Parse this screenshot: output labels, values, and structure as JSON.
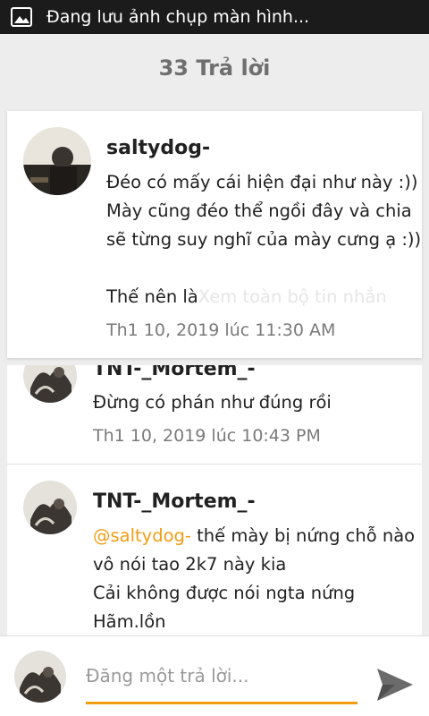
{
  "status_bar": {
    "icon": "image-icon",
    "text": "Đang lưu ảnh chụp màn hình..."
  },
  "header": {
    "title": "33 Trả lời"
  },
  "comments": [
    {
      "author": "saltydog-",
      "lines": [
        "Đéo có mấy cái hiện đại như này :))",
        "Mày cũng đéo thể ngồi đây và chia",
        "sẽ từng suy nghĩ của mày cưng ạ :))",
        "",
        "Thế nên là"
      ],
      "see_more": "Xem toàn bộ tin nhắn",
      "time": "Th1 10, 2019 lúc 11:30 AM"
    },
    {
      "author": "TNT-_Mortem_-",
      "lines": [
        "Đừng có phán như đúng rồi"
      ],
      "time": "Th1 10, 2019 lúc 10:43 PM"
    },
    {
      "author": "TNT-_Mortem_-",
      "mention": "@saltydog-",
      "lines": [
        " thế mày bị nứng chỗ nào",
        "vô nói tao 2k7 này kia",
        "Cải không được nói ngta nứng",
        "Hãm.lồn"
      ]
    }
  ],
  "compose": {
    "placeholder": "Đăng một trả lời...",
    "send_icon": "send-icon"
  },
  "colors": {
    "accent": "#f39c12",
    "status_bar": "#1b1b1b",
    "background": "#ededed"
  }
}
